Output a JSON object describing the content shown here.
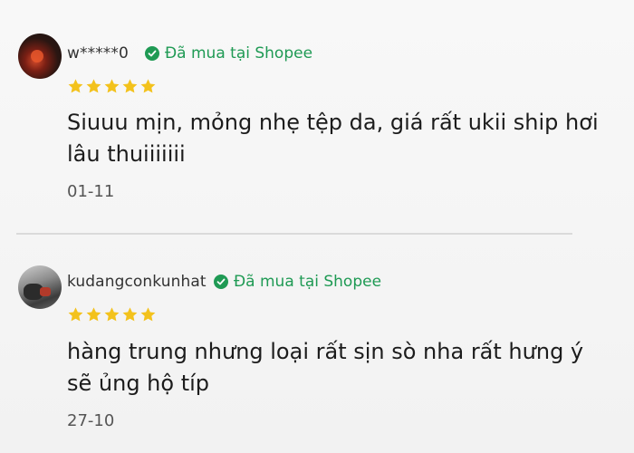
{
  "colors": {
    "verified_green": "#1f9a54",
    "star_yellow": "#f3c21c",
    "text_dark": "#1c1c1c",
    "text_gray": "#555555"
  },
  "icons": {
    "verified": "check-circle-icon",
    "rating_star": "star-icon"
  },
  "reviews": [
    {
      "username": "w*****0",
      "verified_label": "Đã mua tại Shopee",
      "rating": 5,
      "comment": "Siuuu mịn, mỏng nhẹ tệp da, giá rất ukii ship hơi lâu thuiiiiiii",
      "date": "01-11"
    },
    {
      "username": "kudangconkunhat",
      "verified_label": "Đã mua tại Shopee",
      "rating": 5,
      "comment": "hàng trung nhưng loại rất sịn sò nha rất hưng ý sẽ ủng hộ típ",
      "date": "27-10"
    }
  ]
}
